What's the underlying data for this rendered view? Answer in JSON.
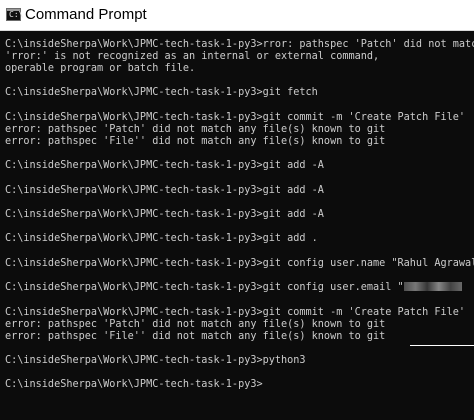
{
  "window": {
    "title": "Command Prompt",
    "icon": "console-window-icon"
  },
  "console": {
    "text_color": "#cccccc",
    "background": "#0c0c0c",
    "lines": [
      "C:\\insideSherpa\\Work\\JPMC-tech-task-1-py3>rror: pathspec 'Patch' did not match any file(s) known to git",
      "'rror:' is not recognized as an internal or external command,",
      "operable program or batch file.",
      "",
      "C:\\insideSherpa\\Work\\JPMC-tech-task-1-py3>git fetch",
      "",
      "C:\\insideSherpa\\Work\\JPMC-tech-task-1-py3>git commit -m 'Create Patch File'",
      "error: pathspec 'Patch' did not match any file(s) known to git",
      "error: pathspec 'File'' did not match any file(s) known to git",
      "",
      "C:\\insideSherpa\\Work\\JPMC-tech-task-1-py3>git add -A",
      "",
      "C:\\insideSherpa\\Work\\JPMC-tech-task-1-py3>git add -A",
      "",
      "C:\\insideSherpa\\Work\\JPMC-tech-task-1-py3>git add -A",
      "",
      "C:\\insideSherpa\\Work\\JPMC-tech-task-1-py3>git add .",
      "",
      "C:\\insideSherpa\\Work\\JPMC-tech-task-1-py3>git config user.name \"Rahul Agrawal\"",
      "",
      "C:\\insideSherpa\\Work\\JPMC-tech-task-1-py3>git config user.email \"",
      "",
      "C:\\insideSherpa\\Work\\JPMC-tech-task-1-py3>git commit -m 'Create Patch File'",
      "error: pathspec 'Patch' did not match any file(s) known to git",
      "error: pathspec 'File'' did not match any file(s) known to git",
      "",
      "C:\\insideSherpa\\Work\\JPMC-tech-task-1-py3>python3",
      "",
      "C:\\insideSherpa\\Work\\JPMC-tech-task-1-py3>"
    ]
  }
}
